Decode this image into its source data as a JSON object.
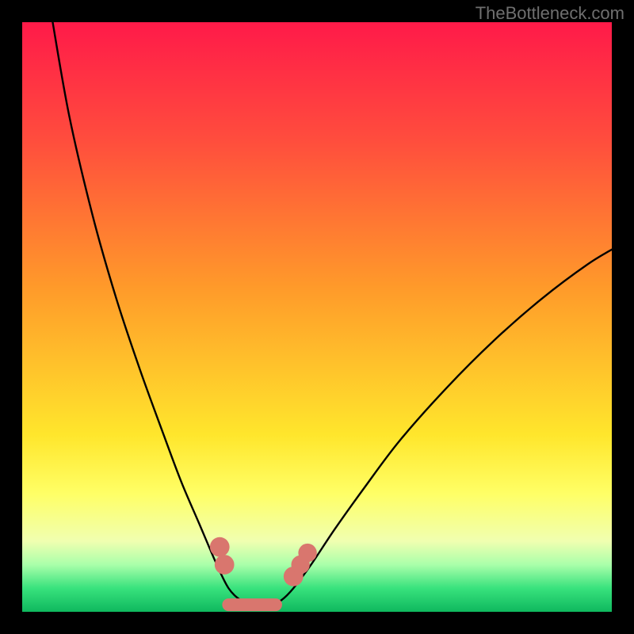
{
  "watermark": "TheBottleneck.com",
  "chart_data": {
    "type": "line",
    "title": "",
    "xlabel": "",
    "ylabel": "",
    "xlim": [
      0,
      100
    ],
    "ylim": [
      0,
      100
    ],
    "grid": false,
    "legend": false,
    "background_gradient": {
      "type": "vertical",
      "stops": [
        {
          "pos": 0.0,
          "color": "#ff1a49"
        },
        {
          "pos": 0.2,
          "color": "#ff4d3d"
        },
        {
          "pos": 0.45,
          "color": "#ff9a2a"
        },
        {
          "pos": 0.7,
          "color": "#ffe62c"
        },
        {
          "pos": 0.8,
          "color": "#ffff66"
        },
        {
          "pos": 0.88,
          "color": "#f0ffb0"
        },
        {
          "pos": 0.92,
          "color": "#aaffaa"
        },
        {
          "pos": 0.96,
          "color": "#38e27d"
        },
        {
          "pos": 1.0,
          "color": "#0fb85e"
        }
      ]
    },
    "series": [
      {
        "name": "left-curve",
        "color": "#000000",
        "points": [
          {
            "x": 5,
            "y": 101
          },
          {
            "x": 8,
            "y": 84
          },
          {
            "x": 12,
            "y": 67
          },
          {
            "x": 16,
            "y": 53
          },
          {
            "x": 20,
            "y": 41
          },
          {
            "x": 24,
            "y": 30
          },
          {
            "x": 27,
            "y": 22
          },
          {
            "x": 30,
            "y": 15
          },
          {
            "x": 33,
            "y": 8
          },
          {
            "x": 35,
            "y": 4
          },
          {
            "x": 37,
            "y": 2
          },
          {
            "x": 39,
            "y": 1
          }
        ]
      },
      {
        "name": "right-curve",
        "color": "#000000",
        "points": [
          {
            "x": 42,
            "y": 1
          },
          {
            "x": 44,
            "y": 2
          },
          {
            "x": 46,
            "y": 4
          },
          {
            "x": 49,
            "y": 8
          },
          {
            "x": 53,
            "y": 14
          },
          {
            "x": 58,
            "y": 21
          },
          {
            "x": 64,
            "y": 29
          },
          {
            "x": 72,
            "y": 38
          },
          {
            "x": 80,
            "y": 46
          },
          {
            "x": 88,
            "y": 53
          },
          {
            "x": 96,
            "y": 59
          },
          {
            "x": 101,
            "y": 62
          }
        ]
      }
    ],
    "markers": {
      "color": "#d9766e",
      "thick_segment": {
        "x1": 35,
        "x2": 43,
        "y": 1.2
      },
      "dots": [
        {
          "x": 33.5,
          "y": 11,
          "r": 1.1
        },
        {
          "x": 34.3,
          "y": 8,
          "r": 1.1
        },
        {
          "x": 46.0,
          "y": 6,
          "r": 1.1
        },
        {
          "x": 47.2,
          "y": 8,
          "r": 1.0
        },
        {
          "x": 48.4,
          "y": 10,
          "r": 1.0
        }
      ]
    }
  }
}
